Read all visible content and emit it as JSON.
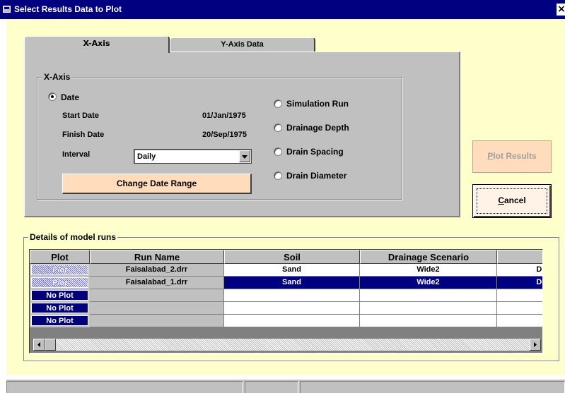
{
  "window": {
    "title": "Select Results Data to Plot",
    "close_glyph": "×"
  },
  "tabs": [
    {
      "label": "X-Axis",
      "selected": true
    },
    {
      "label": "Y-Axis Data",
      "selected": false
    }
  ],
  "xaxis_group": {
    "label": "X-Axis",
    "date_option": "Date",
    "start_date_label": "Start Date",
    "start_date_value": "01/Jan/1975",
    "finish_date_label": "Finish Date",
    "finish_date_value": "20/Sep/1975",
    "interval_label": "Interval",
    "interval_value": "Daily",
    "change_date_button": "Change Date Range",
    "radio_options": [
      "Simulation Run",
      "Drainage Depth",
      "Drain Spacing",
      "Drain Diameter"
    ]
  },
  "buttons": {
    "plot_results_prefix": "P",
    "plot_results_rest": "lot Results",
    "cancel_prefix": "C",
    "cancel_rest": "ancel"
  },
  "details_group": {
    "label": "Details of model runs",
    "columns": [
      "Plot",
      "Run Name",
      "Soil",
      "Drainage Scenario",
      ""
    ],
    "rows": [
      {
        "plot": "Plot",
        "run": "Faisalabad_2.drr",
        "soil": "Sand",
        "scenario": "Wide2",
        "extra": "D:"
      },
      {
        "plot": "Plot",
        "run": "Faisalabad_1.drr",
        "soil": "Sand",
        "scenario": "Wide2",
        "extra": "D:"
      },
      {
        "plot": "No Plot",
        "run": "",
        "soil": "",
        "scenario": "",
        "extra": ""
      },
      {
        "plot": "No Plot",
        "run": "",
        "soil": "",
        "scenario": "",
        "extra": ""
      },
      {
        "plot": "No Plot",
        "run": "",
        "soil": "",
        "scenario": "",
        "extra": ""
      }
    ]
  },
  "colors": {
    "title_bar": "#000080",
    "client_bg": "#ffffcc",
    "selected_row": "#000080",
    "button_face": "#ffdcbc"
  }
}
